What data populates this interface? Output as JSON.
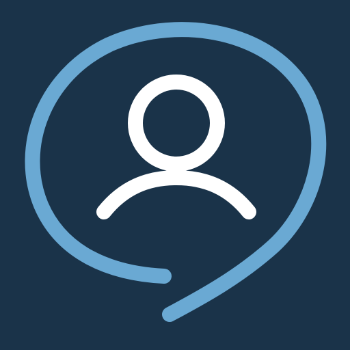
{
  "icon": {
    "name": "user-speech-bubble",
    "background_color": "#1a3349",
    "bubble_color": "#6aa9d3",
    "person_color": "#ffffff"
  }
}
